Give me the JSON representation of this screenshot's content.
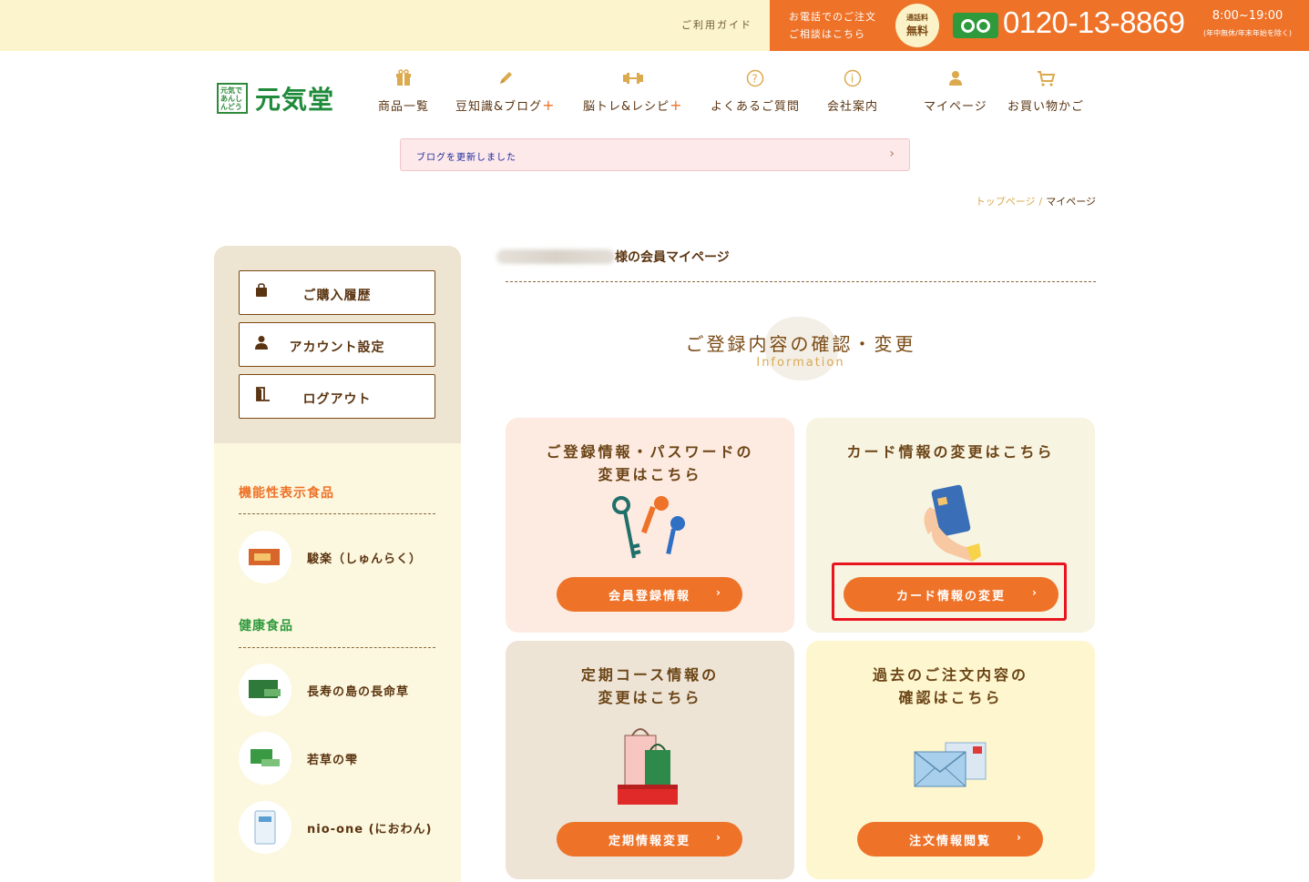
{
  "topbar": {
    "guide": "ご利用ガイド",
    "phone_note_line1": "お電話でのご注文",
    "phone_note_line2": "ご相談はこちら",
    "free_badge_small": "通話料",
    "free_badge_big": "無料",
    "phone_number": "0120-13-8869",
    "hours": "8:00~19:00",
    "hours_note": "(年中無休/年末年始を除く)"
  },
  "logo": {
    "mark": "元気であんしんどう",
    "text": "元気堂"
  },
  "nav": [
    {
      "label": "商品一覧",
      "icon": "gift-icon"
    },
    {
      "label": "豆知識&ブログ",
      "icon": "pencil-icon",
      "plus": "+"
    },
    {
      "label": "脳トレ&レシピ",
      "icon": "dumbbell-icon",
      "plus": "+"
    },
    {
      "label": "よくあるご質問",
      "icon": "question-icon"
    },
    {
      "label": "会社案内",
      "icon": "info-icon"
    },
    {
      "label": "マイページ",
      "icon": "user-icon"
    },
    {
      "label": "お買い物かご",
      "icon": "cart-icon"
    }
  ],
  "notice": {
    "text": "ブログを更新しました",
    "arrow": "›"
  },
  "breadcrumb": {
    "home": "トップページ",
    "sep": "/",
    "current": "マイページ"
  },
  "sidebar": {
    "buttons": [
      {
        "label": "ご購入履歴",
        "icon": "bag-icon"
      },
      {
        "label": "アカウント設定",
        "icon": "user-icon"
      },
      {
        "label": "ログアウト",
        "icon": "door-icon"
      }
    ],
    "sections": [
      {
        "heading": "機能性表示食品",
        "color": "#ee7228",
        "products": [
          "駿楽（しゅんらく）"
        ]
      },
      {
        "heading": "健康食品",
        "color": "#2e9a3c",
        "products": [
          "長寿の島の長命草",
          "若草の雫",
          "nio-one (におわん)"
        ]
      }
    ]
  },
  "main": {
    "member_suffix": "様の会員マイページ",
    "section_title": "ご登録内容の確認・変更",
    "section_sub": "Information",
    "cards": [
      {
        "title_line1": "ご登録情報・パスワードの",
        "title_line2": "変更はこちら",
        "button": "会員登録情報",
        "bg": "#fdeae0",
        "illus": "keys-icon"
      },
      {
        "title_line1": "カード情報の変更はこちら",
        "title_line2": "",
        "button": "カード情報の変更",
        "bg": "#f8f4e2",
        "illus": "credit-card-icon"
      },
      {
        "title_line1": "定期コース情報の",
        "title_line2": "変更はこちら",
        "button": "定期情報変更",
        "bg": "#ede4d6",
        "illus": "shopping-bags-icon"
      },
      {
        "title_line1": "過去のご注文内容の",
        "title_line2": "確認はこちら",
        "button": "注文情報閲覧",
        "bg": "#fdf6cf",
        "illus": "envelope-icon"
      }
    ],
    "button_arrow": "›"
  },
  "colors": {
    "accent": "#ee7228",
    "brand_green": "#1f8a3a",
    "text_brown": "#7a4a14",
    "highlight": "#e8141e"
  }
}
